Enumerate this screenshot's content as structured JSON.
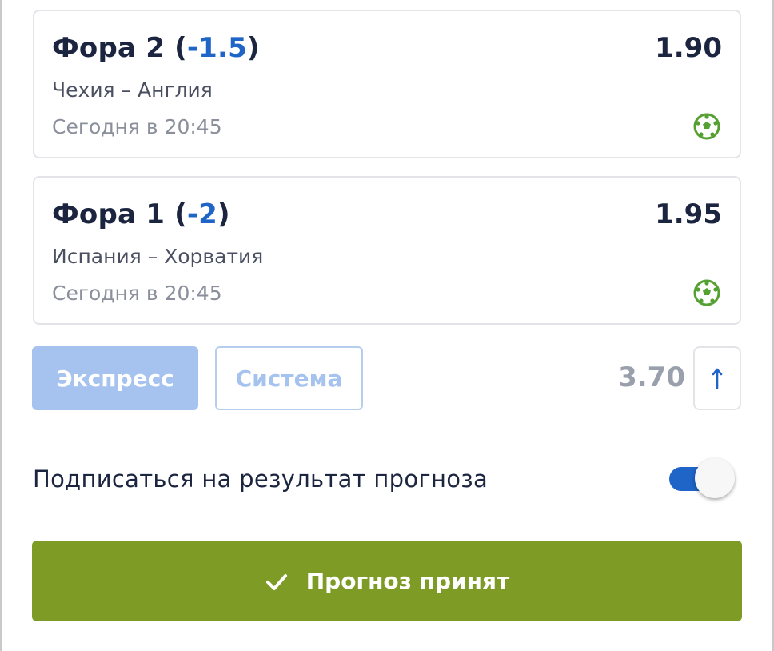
{
  "bets": [
    {
      "market_prefix": "Фора 2 (",
      "handicap": "-1.5",
      "market_suffix": ")",
      "odds": "1.90",
      "teams": "Чехия – Англия",
      "time": "Сегодня в 20:45",
      "sport_icon": "soccer-ball-icon"
    },
    {
      "market_prefix": "Фора 1 (",
      "handicap": "-2",
      "market_suffix": ")",
      "odds": "1.95",
      "teams": "Испания – Хорватия",
      "time": "Сегодня в 20:45",
      "sport_icon": "soccer-ball-icon"
    }
  ],
  "bet_type": {
    "express_label": "Экспресс",
    "system_label": "Система",
    "selected": "Экспресс"
  },
  "total_odds": "3.70",
  "arrow_icon": "arrow-up-icon",
  "subscribe": {
    "label": "Подписаться на результат прогноза",
    "enabled": true
  },
  "submit": {
    "label": "Прогноз принят",
    "icon": "checkmark-icon"
  },
  "colors": {
    "accent_blue": "#1f64c7",
    "submit_green": "#7e9b26",
    "express_light_blue": "#a5c3ee",
    "sport_icon_green": "#54a030"
  }
}
